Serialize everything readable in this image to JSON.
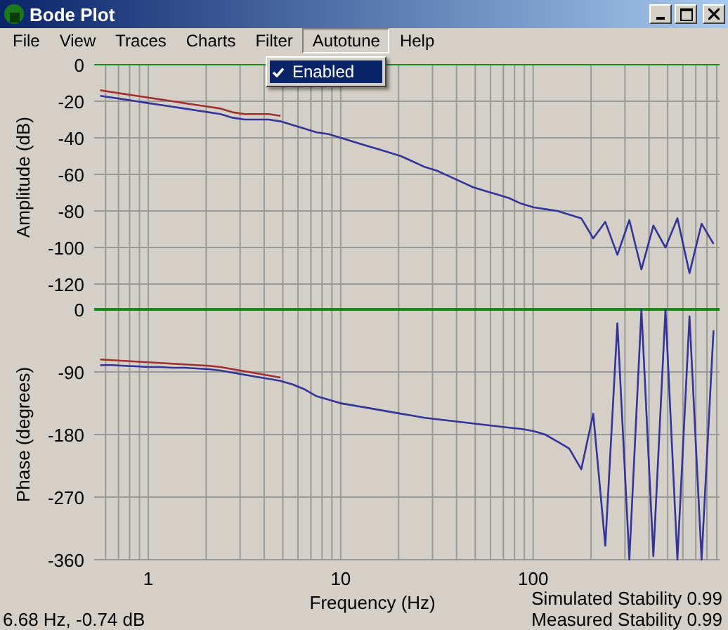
{
  "window": {
    "title": "Bode Plot"
  },
  "menu": [
    {
      "label": "File",
      "selected": false
    },
    {
      "label": "View",
      "selected": false
    },
    {
      "label": "Traces",
      "selected": false
    },
    {
      "label": "Charts",
      "selected": false
    },
    {
      "label": "Filter",
      "selected": false
    },
    {
      "label": "Autotune",
      "selected": true
    },
    {
      "label": "Help",
      "selected": false
    }
  ],
  "dropdown": {
    "items": [
      {
        "label": "Enabled",
        "checked": true,
        "selected": true
      }
    ]
  },
  "amplitude": {
    "chart_data": {
      "type": "line",
      "ylabel": "Amplitude (dB)",
      "grid": true,
      "ylim": [
        -120,
        0
      ],
      "yticks": [
        0,
        -20,
        -40,
        -60,
        -80,
        -100,
        -120
      ],
      "categories": [
        null,
        null,
        null,
        null,
        null,
        null,
        null,
        null,
        null,
        null,
        null,
        null,
        null,
        null,
        null,
        null,
        null,
        null,
        null,
        null,
        null,
        null,
        null,
        null,
        null,
        null,
        null,
        null,
        null,
        null,
        null,
        null,
        null,
        null,
        null,
        null,
        null,
        null,
        null,
        null,
        null,
        null,
        null,
        null,
        null,
        null,
        null,
        null,
        null,
        null,
        null,
        null
      ],
      "series": [
        {
          "color": "#333399",
          "values": [
            -17,
            -18,
            -19,
            -20,
            -21,
            -22,
            -23,
            -24,
            -25,
            -26,
            -27,
            -29,
            -30,
            -30,
            -30,
            -31,
            -33,
            -35,
            -37,
            -38,
            -40,
            -42,
            -44,
            -46,
            -48,
            -50,
            -53,
            -56,
            -58,
            -61,
            -64,
            -67,
            -69,
            -71,
            -73,
            -76,
            -78,
            -79,
            -80,
            -82,
            -84,
            -95,
            -86,
            -104,
            -85,
            -112,
            -88,
            -100,
            -84,
            -114,
            -87,
            -98
          ]
        },
        {
          "color": "#a03030",
          "values": [
            -14,
            -15,
            -16,
            -17,
            -18,
            -19,
            -20,
            -21,
            -22,
            -23,
            -24,
            -26,
            -27,
            -27,
            -27,
            -28,
            null,
            null,
            null,
            null,
            null,
            null,
            null,
            null,
            null,
            null,
            null,
            null,
            null,
            null,
            null,
            null,
            null,
            null,
            null,
            null,
            null,
            null,
            null,
            null,
            null,
            null,
            null,
            null,
            null,
            null,
            null,
            null,
            null,
            null,
            null,
            null
          ]
        }
      ]
    }
  },
  "phase": {
    "chart_data": {
      "type": "line",
      "ylabel": "Phase (degrees)",
      "xlabel": "Frequency (Hz)",
      "grid": true,
      "ylim": [
        -360,
        0
      ],
      "yticks": [
        0,
        -90,
        -180,
        -270,
        -360
      ],
      "categories": [
        null,
        null,
        null,
        null,
        "1",
        null,
        null,
        null,
        null,
        null,
        null,
        null,
        null,
        null,
        null,
        null,
        null,
        null,
        null,
        null,
        "10",
        null,
        null,
        null,
        null,
        null,
        null,
        null,
        null,
        null,
        null,
        null,
        null,
        null,
        null,
        null,
        "100",
        null,
        null,
        null,
        null,
        null,
        null,
        null,
        null,
        null,
        null,
        null,
        null,
        null,
        null,
        null
      ],
      "series": [
        {
          "color": "#333399",
          "values": [
            -80,
            -80,
            -81,
            -82,
            -83,
            -83,
            -84,
            -84,
            -85,
            -86,
            -88,
            -91,
            -94,
            -97,
            -100,
            -103,
            -108,
            -115,
            -125,
            -130,
            -135,
            -138,
            -141,
            -144,
            -147,
            -150,
            -153,
            -156,
            -158,
            -160,
            -162,
            -164,
            -166,
            -168,
            -170,
            -172,
            -175,
            -180,
            -190,
            -200,
            -230,
            -150,
            -340,
            -20,
            -360,
            0,
            -355,
            0,
            -360,
            -10,
            -360,
            -30
          ]
        },
        {
          "color": "#a03030",
          "values": [
            -72,
            -73,
            -74,
            -75,
            -76,
            -77,
            -78,
            -79,
            -80,
            -81,
            -83,
            -86,
            -89,
            -92,
            -95,
            -98,
            null,
            null,
            null,
            null,
            null,
            null,
            null,
            null,
            null,
            null,
            null,
            null,
            null,
            null,
            null,
            null,
            null,
            null,
            null,
            null,
            null,
            null,
            null,
            null,
            null,
            null,
            null,
            null,
            null,
            null,
            null,
            null,
            null,
            null,
            null,
            null
          ]
        }
      ]
    }
  },
  "status": {
    "cursor": "6.68 Hz, -0.74 dB",
    "simulated": "Simulated Stability 0.99",
    "measured": "Measured Stability 0.99"
  }
}
